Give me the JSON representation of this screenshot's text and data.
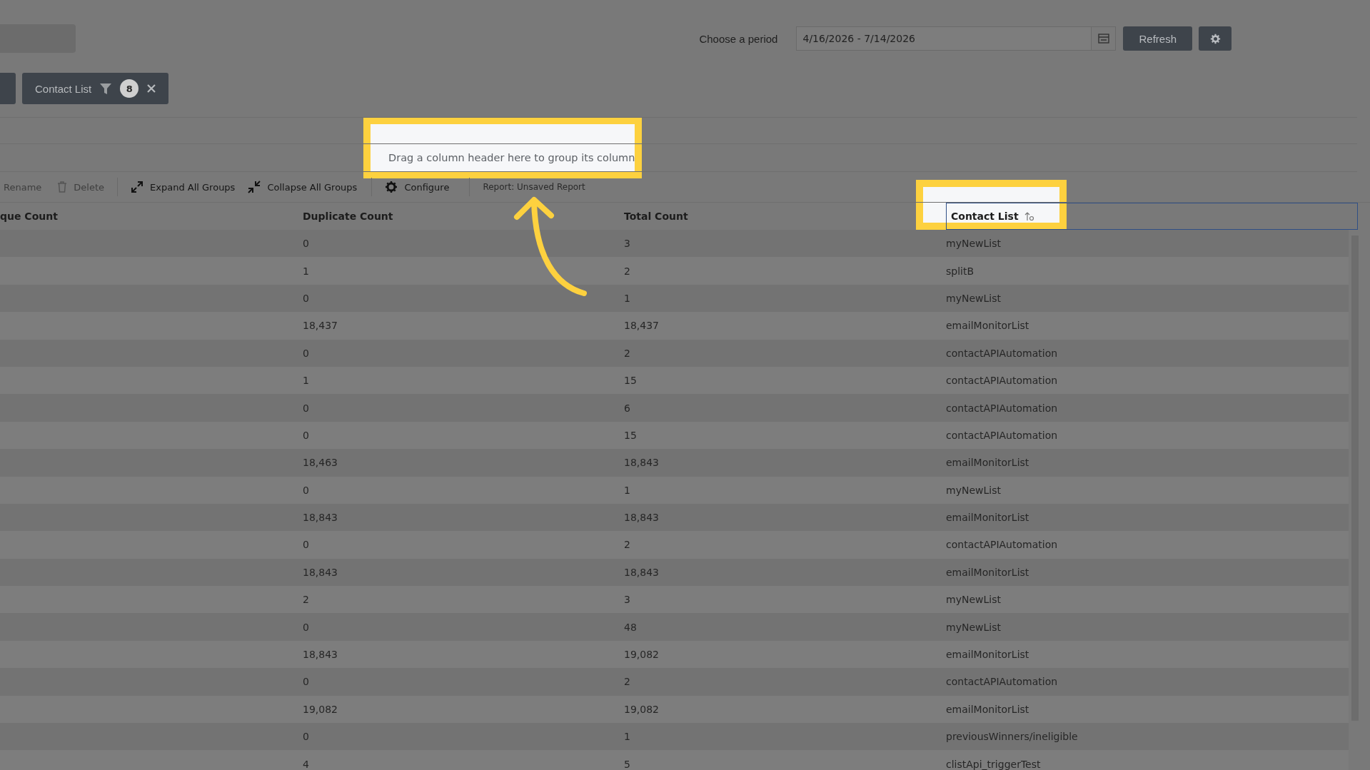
{
  "top_bar": {
    "period_label": "Choose a period",
    "period_value": "4/16/2026 - 7/14/2026",
    "refresh_button": "Refresh"
  },
  "filter_chips": [
    {
      "label": "Contact List",
      "count": "8"
    }
  ],
  "group_panel": {
    "hint": "Drag a column header here to group its column"
  },
  "toolbar": [
    {
      "kind": "plain",
      "label": "Rename",
      "disabled": true
    },
    {
      "kind": "trash",
      "label": "Delete",
      "disabled": true
    },
    {
      "kind": "expand",
      "label": "Expand All Groups",
      "disabled": false
    },
    {
      "kind": "collapse",
      "label": "Collapse All Groups",
      "disabled": false
    },
    {
      "kind": "gear",
      "label": "Configure",
      "disabled": false
    }
  ],
  "report": {
    "label": "Report:",
    "value": "Unsaved Report"
  },
  "table": {
    "columns": [
      "que Count",
      "Duplicate Count",
      "Total Count",
      "Contact List"
    ],
    "rows": [
      [
        "",
        "0",
        "3",
        "myNewList"
      ],
      [
        "",
        "1",
        "2",
        "splitB"
      ],
      [
        "",
        "0",
        "1",
        "myNewList"
      ],
      [
        "",
        "18,437",
        "18,437",
        "emailMonitorList"
      ],
      [
        "",
        "0",
        "2",
        "contactAPIAutomation"
      ],
      [
        "",
        "1",
        "15",
        "contactAPIAutomation"
      ],
      [
        "",
        "0",
        "6",
        "contactAPIAutomation"
      ],
      [
        "",
        "0",
        "15",
        "contactAPIAutomation"
      ],
      [
        "",
        "18,463",
        "18,843",
        "emailMonitorList"
      ],
      [
        "",
        "0",
        "1",
        "myNewList"
      ],
      [
        "",
        "18,843",
        "18,843",
        "emailMonitorList"
      ],
      [
        "",
        "0",
        "2",
        "contactAPIAutomation"
      ],
      [
        "",
        "18,843",
        "18,843",
        "emailMonitorList"
      ],
      [
        "",
        "2",
        "3",
        "myNewList"
      ],
      [
        "",
        "0",
        "48",
        "myNewList"
      ],
      [
        "",
        "18,843",
        "19,082",
        "emailMonitorList"
      ],
      [
        "",
        "0",
        "2",
        "contactAPIAutomation"
      ],
      [
        "",
        "19,082",
        "19,082",
        "emailMonitorList"
      ],
      [
        "",
        "0",
        "1",
        "previousWinners/ineligible"
      ],
      [
        "",
        "4",
        "5",
        "clistApi_triggerTest"
      ]
    ]
  }
}
